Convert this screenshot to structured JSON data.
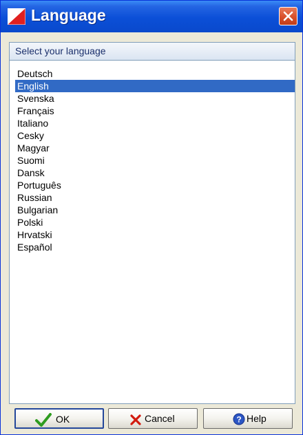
{
  "window": {
    "title": "Language"
  },
  "header": {
    "label": "Select your language"
  },
  "languages": [
    {
      "label": "Deutsch",
      "selected": false
    },
    {
      "label": "English",
      "selected": true
    },
    {
      "label": "Svenska",
      "selected": false
    },
    {
      "label": "Français",
      "selected": false
    },
    {
      "label": "Italiano",
      "selected": false
    },
    {
      "label": "Cesky",
      "selected": false
    },
    {
      "label": "Magyar",
      "selected": false
    },
    {
      "label": "Suomi",
      "selected": false
    },
    {
      "label": "Dansk",
      "selected": false
    },
    {
      "label": "Português",
      "selected": false
    },
    {
      "label": "Russian",
      "selected": false
    },
    {
      "label": "Bulgarian",
      "selected": false
    },
    {
      "label": "Polski",
      "selected": false
    },
    {
      "label": "Hrvatski",
      "selected": false
    },
    {
      "label": "Español",
      "selected": false
    }
  ],
  "buttons": {
    "ok": {
      "label": "OK",
      "icon": "checkmark-icon"
    },
    "cancel": {
      "label": "Cancel",
      "icon": "x-icon"
    },
    "help": {
      "label": "Help",
      "icon": "help-icon"
    }
  },
  "colors": {
    "titlebar": "#0b4fd7",
    "selection": "#316ac5",
    "close_button": "#d9502b",
    "ok_check": "#2e9c1f",
    "cancel_x": "#d21a0e",
    "help_circle": "#2c56c4"
  }
}
